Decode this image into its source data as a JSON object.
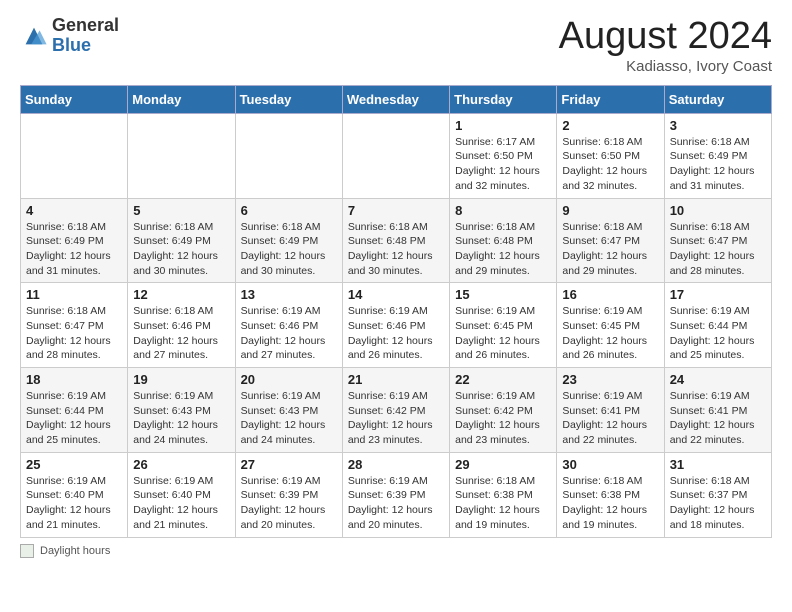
{
  "logo": {
    "general": "General",
    "blue": "Blue"
  },
  "title": "August 2024",
  "subtitle": "Kadiasso, Ivory Coast",
  "days_of_week": [
    "Sunday",
    "Monday",
    "Tuesday",
    "Wednesday",
    "Thursday",
    "Friday",
    "Saturday"
  ],
  "footer": {
    "box_label": "Daylight hours"
  },
  "weeks": [
    [
      {
        "day": "",
        "info": ""
      },
      {
        "day": "",
        "info": ""
      },
      {
        "day": "",
        "info": ""
      },
      {
        "day": "",
        "info": ""
      },
      {
        "day": "1",
        "info": "Sunrise: 6:17 AM\nSunset: 6:50 PM\nDaylight: 12 hours\nand 32 minutes."
      },
      {
        "day": "2",
        "info": "Sunrise: 6:18 AM\nSunset: 6:50 PM\nDaylight: 12 hours\nand 32 minutes."
      },
      {
        "day": "3",
        "info": "Sunrise: 6:18 AM\nSunset: 6:49 PM\nDaylight: 12 hours\nand 31 minutes."
      }
    ],
    [
      {
        "day": "4",
        "info": "Sunrise: 6:18 AM\nSunset: 6:49 PM\nDaylight: 12 hours\nand 31 minutes."
      },
      {
        "day": "5",
        "info": "Sunrise: 6:18 AM\nSunset: 6:49 PM\nDaylight: 12 hours\nand 30 minutes."
      },
      {
        "day": "6",
        "info": "Sunrise: 6:18 AM\nSunset: 6:49 PM\nDaylight: 12 hours\nand 30 minutes."
      },
      {
        "day": "7",
        "info": "Sunrise: 6:18 AM\nSunset: 6:48 PM\nDaylight: 12 hours\nand 30 minutes."
      },
      {
        "day": "8",
        "info": "Sunrise: 6:18 AM\nSunset: 6:48 PM\nDaylight: 12 hours\nand 29 minutes."
      },
      {
        "day": "9",
        "info": "Sunrise: 6:18 AM\nSunset: 6:47 PM\nDaylight: 12 hours\nand 29 minutes."
      },
      {
        "day": "10",
        "info": "Sunrise: 6:18 AM\nSunset: 6:47 PM\nDaylight: 12 hours\nand 28 minutes."
      }
    ],
    [
      {
        "day": "11",
        "info": "Sunrise: 6:18 AM\nSunset: 6:47 PM\nDaylight: 12 hours\nand 28 minutes."
      },
      {
        "day": "12",
        "info": "Sunrise: 6:18 AM\nSunset: 6:46 PM\nDaylight: 12 hours\nand 27 minutes."
      },
      {
        "day": "13",
        "info": "Sunrise: 6:19 AM\nSunset: 6:46 PM\nDaylight: 12 hours\nand 27 minutes."
      },
      {
        "day": "14",
        "info": "Sunrise: 6:19 AM\nSunset: 6:46 PM\nDaylight: 12 hours\nand 26 minutes."
      },
      {
        "day": "15",
        "info": "Sunrise: 6:19 AM\nSunset: 6:45 PM\nDaylight: 12 hours\nand 26 minutes."
      },
      {
        "day": "16",
        "info": "Sunrise: 6:19 AM\nSunset: 6:45 PM\nDaylight: 12 hours\nand 26 minutes."
      },
      {
        "day": "17",
        "info": "Sunrise: 6:19 AM\nSunset: 6:44 PM\nDaylight: 12 hours\nand 25 minutes."
      }
    ],
    [
      {
        "day": "18",
        "info": "Sunrise: 6:19 AM\nSunset: 6:44 PM\nDaylight: 12 hours\nand 25 minutes."
      },
      {
        "day": "19",
        "info": "Sunrise: 6:19 AM\nSunset: 6:43 PM\nDaylight: 12 hours\nand 24 minutes."
      },
      {
        "day": "20",
        "info": "Sunrise: 6:19 AM\nSunset: 6:43 PM\nDaylight: 12 hours\nand 24 minutes."
      },
      {
        "day": "21",
        "info": "Sunrise: 6:19 AM\nSunset: 6:42 PM\nDaylight: 12 hours\nand 23 minutes."
      },
      {
        "day": "22",
        "info": "Sunrise: 6:19 AM\nSunset: 6:42 PM\nDaylight: 12 hours\nand 23 minutes."
      },
      {
        "day": "23",
        "info": "Sunrise: 6:19 AM\nSunset: 6:41 PM\nDaylight: 12 hours\nand 22 minutes."
      },
      {
        "day": "24",
        "info": "Sunrise: 6:19 AM\nSunset: 6:41 PM\nDaylight: 12 hours\nand 22 minutes."
      }
    ],
    [
      {
        "day": "25",
        "info": "Sunrise: 6:19 AM\nSunset: 6:40 PM\nDaylight: 12 hours\nand 21 minutes."
      },
      {
        "day": "26",
        "info": "Sunrise: 6:19 AM\nSunset: 6:40 PM\nDaylight: 12 hours\nand 21 minutes."
      },
      {
        "day": "27",
        "info": "Sunrise: 6:19 AM\nSunset: 6:39 PM\nDaylight: 12 hours\nand 20 minutes."
      },
      {
        "day": "28",
        "info": "Sunrise: 6:19 AM\nSunset: 6:39 PM\nDaylight: 12 hours\nand 20 minutes."
      },
      {
        "day": "29",
        "info": "Sunrise: 6:18 AM\nSunset: 6:38 PM\nDaylight: 12 hours\nand 19 minutes."
      },
      {
        "day": "30",
        "info": "Sunrise: 6:18 AM\nSunset: 6:38 PM\nDaylight: 12 hours\nand 19 minutes."
      },
      {
        "day": "31",
        "info": "Sunrise: 6:18 AM\nSunset: 6:37 PM\nDaylight: 12 hours\nand 18 minutes."
      }
    ]
  ]
}
